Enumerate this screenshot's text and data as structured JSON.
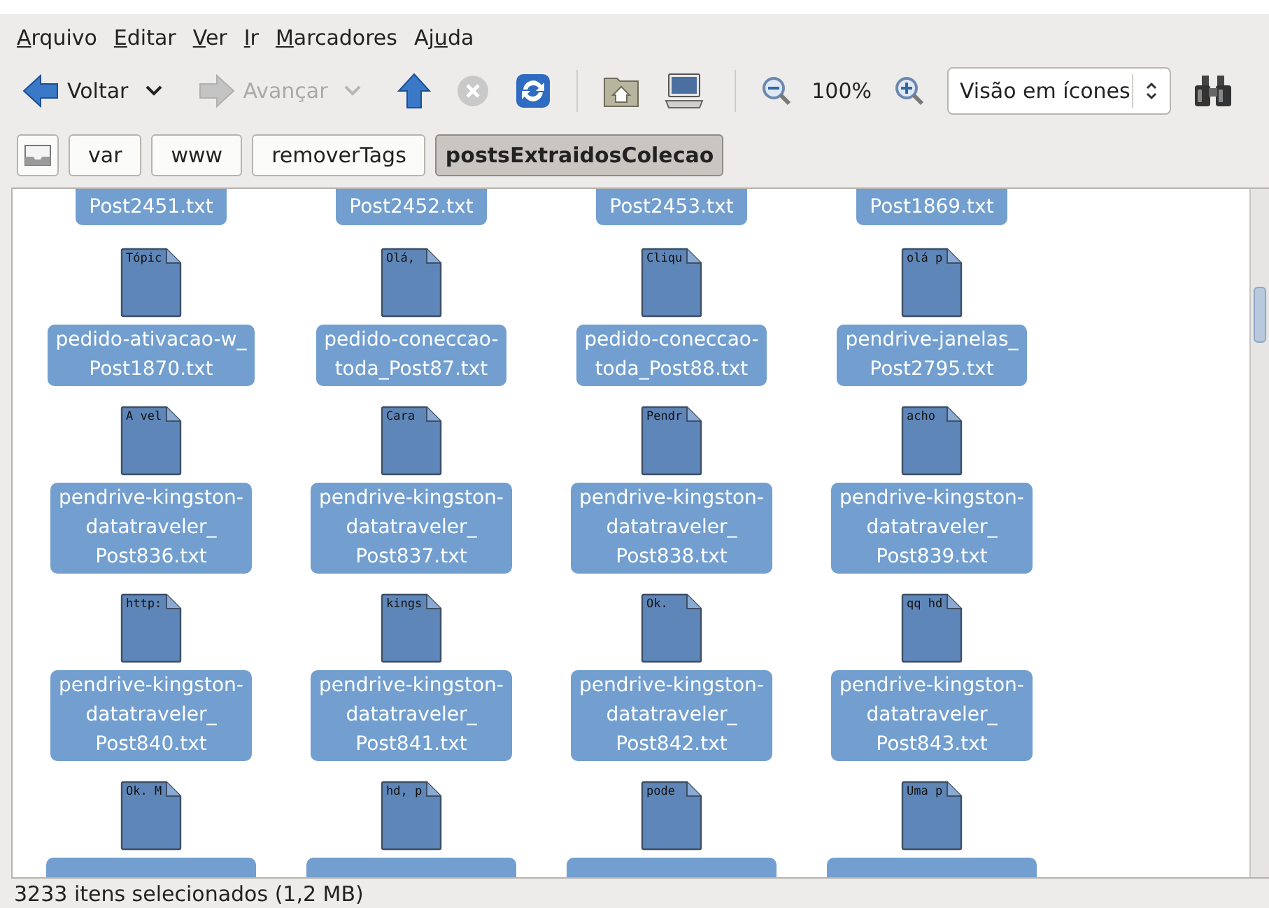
{
  "menubar": [
    {
      "key": "A",
      "post": "rquivo"
    },
    {
      "key": "E",
      "post": "ditar"
    },
    {
      "key": "V",
      "post": "er"
    },
    {
      "key": "I",
      "post": "r"
    },
    {
      "key": "M",
      "post": "arcadores"
    },
    {
      "pre": "Aj",
      "key": "u",
      "post": "da"
    }
  ],
  "toolbar": [
    {
      "kind": "back",
      "label": "Voltar",
      "disabled": false
    },
    {
      "kind": "menu_arrow",
      "disabled": false
    },
    {
      "kind": "forward",
      "label": "Avançar",
      "disabled": true
    },
    {
      "kind": "menu_arrow",
      "disabled": true
    },
    {
      "kind": "up",
      "disabled": false
    },
    {
      "kind": "stop",
      "disabled": true
    },
    {
      "kind": "reload",
      "disabled": false
    },
    {
      "kind": "separator"
    },
    {
      "kind": "home"
    },
    {
      "kind": "computer"
    },
    {
      "kind": "separator"
    },
    {
      "kind": "zoom_out"
    },
    {
      "kind": "zoom_level",
      "label": "100%"
    },
    {
      "kind": "zoom_in"
    },
    {
      "kind": "view_select",
      "value": "Visão em ícones"
    },
    {
      "kind": "search"
    }
  ],
  "pathbar": [
    {
      "kind": "toggle",
      "selected": false
    },
    {
      "kind": "crumb",
      "label": "var",
      "selected": false
    },
    {
      "kind": "crumb",
      "label": "www",
      "selected": false
    },
    {
      "kind": "crumb",
      "label": "removerTags",
      "selected": false
    },
    {
      "kind": "crumb",
      "label": "postsExtraidosColecao",
      "selected": true
    }
  ],
  "files": [
    {
      "kind": "cut_top",
      "items": [
        {
          "name": "Post2451.txt",
          "selected": true
        },
        {
          "name": "Post2452.txt",
          "selected": true
        },
        {
          "name": "Post2453.txt",
          "selected": true
        },
        {
          "name": "Post1869.txt",
          "selected": true
        }
      ]
    },
    {
      "kind": "full",
      "items": [
        {
          "preview": "Tópic",
          "name": "pedido-ativacao-w_\nPost1870.txt",
          "selected": true
        },
        {
          "preview": "Olá,",
          "name": "pedido-coneccao-\ntoda_Post87.txt",
          "selected": true
        },
        {
          "preview": "Cliqu",
          "name": "pedido-coneccao-\ntoda_Post88.txt",
          "selected": true
        },
        {
          "preview": "olá p",
          "name": "pendrive-janelas_\nPost2795.txt",
          "selected": true
        }
      ]
    },
    {
      "kind": "full",
      "items": [
        {
          "preview": "A vel",
          "name": "pendrive-kingston-\ndatatraveler_\nPost836.txt",
          "selected": true
        },
        {
          "preview": "Cara",
          "name": "pendrive-kingston-\ndatatraveler_\nPost837.txt",
          "selected": true
        },
        {
          "preview": "Pendr",
          "name": "pendrive-kingston-\ndatatraveler_\nPost838.txt",
          "selected": true
        },
        {
          "preview": "acho",
          "name": "pendrive-kingston-\ndatatraveler_\nPost839.txt",
          "selected": true
        }
      ]
    },
    {
      "kind": "full",
      "items": [
        {
          "preview": "http:",
          "name": "pendrive-kingston-\ndatatraveler_\nPost840.txt",
          "selected": true
        },
        {
          "preview": "kings",
          "name": "pendrive-kingston-\ndatatraveler_\nPost841.txt",
          "selected": true
        },
        {
          "preview": "Ok.",
          "name": "pendrive-kingston-\ndatatraveler_\nPost842.txt",
          "selected": true
        },
        {
          "preview": "qq hd",
          "name": "pendrive-kingston-\ndatatraveler_\nPost843.txt",
          "selected": true
        }
      ]
    },
    {
      "kind": "cut_bottom",
      "items": [
        {
          "preview": "Ok. M",
          "selected": true
        },
        {
          "preview": "hd, p",
          "selected": true
        },
        {
          "preview": "pode",
          "selected": true
        },
        {
          "preview": "Uma p",
          "selected": true
        }
      ]
    }
  ],
  "status_bar": "3233 itens selecionados (1,2 MB)"
}
